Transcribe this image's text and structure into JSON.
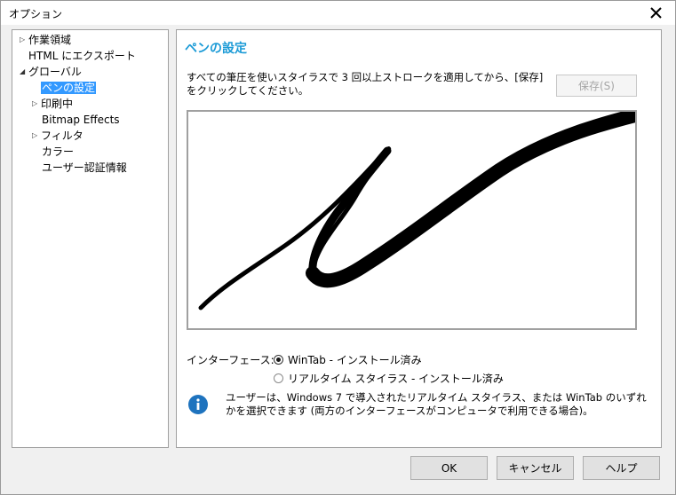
{
  "window": {
    "title": "オプション"
  },
  "tree": {
    "items": [
      {
        "label": "作業領域",
        "expander": "collapsed",
        "indent": 0
      },
      {
        "label": "HTML にエクスポート",
        "expander": "none",
        "indent": 0
      },
      {
        "label": "グローバル",
        "expander": "expanded",
        "indent": 0
      },
      {
        "label": "ペンの設定",
        "expander": "none",
        "indent": 1,
        "selected": true
      },
      {
        "label": "印刷中",
        "expander": "collapsed",
        "indent": 1
      },
      {
        "label": "Bitmap Effects",
        "expander": "none",
        "indent": 1
      },
      {
        "label": "フィルタ",
        "expander": "collapsed",
        "indent": 1
      },
      {
        "label": "カラー",
        "expander": "none",
        "indent": 1
      },
      {
        "label": "ユーザー認証情報",
        "expander": "none",
        "indent": 1
      }
    ]
  },
  "panel": {
    "title": "ペンの設定",
    "instructions": "すべての筆圧を使いスタイラスで 3 回以上ストロークを適用してから、[保存] をクリックしてください。",
    "save_label": "保存(S)",
    "interface_label": "インターフェース:",
    "options": [
      {
        "label": "WinTab - インストール済み",
        "checked": true
      },
      {
        "label": "リアルタイム スタイラス - インストール済み",
        "checked": false
      }
    ],
    "info_text": "ユーザーは、Windows 7 で導入されたリアルタイム スタイラス、または WinTab のいずれかを選択できます (両方のインターフェースがコンピュータで利用できる場合)。"
  },
  "buttons": {
    "ok": "OK",
    "cancel": "キャンセル",
    "help": "ヘルプ"
  },
  "colors": {
    "accent": "#1a9ad6",
    "selection": "#3399ff",
    "info_icon": "#1e73be"
  },
  "icons": {
    "close": "close-icon",
    "info": "info-icon"
  }
}
